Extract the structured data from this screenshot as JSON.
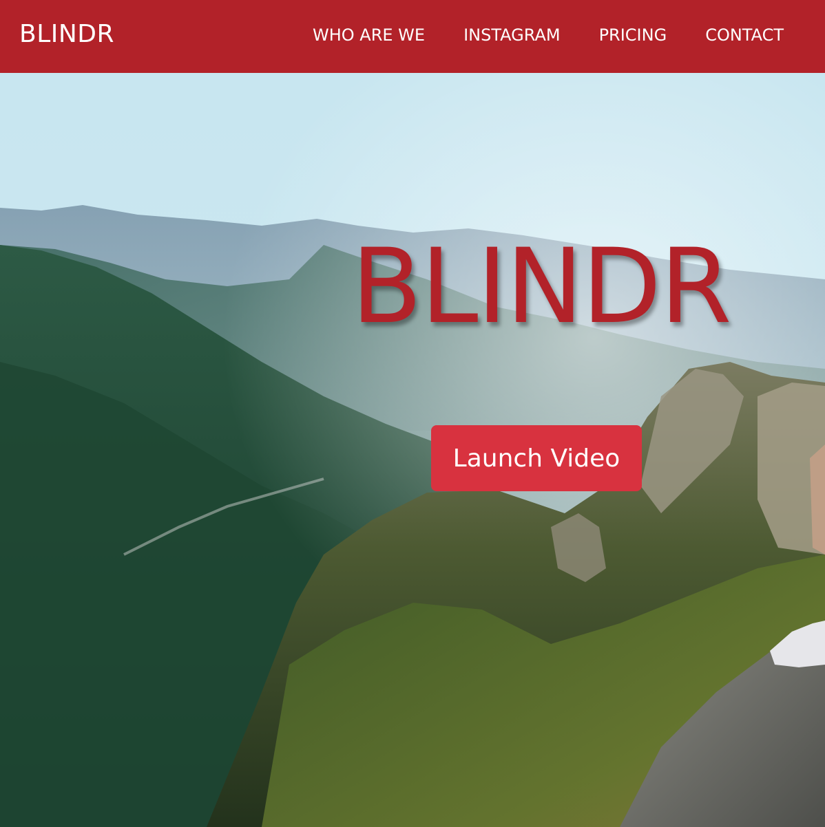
{
  "navbar": {
    "brand": "BLINDR",
    "links": [
      {
        "label": "WHO ARE WE"
      },
      {
        "label": "INSTAGRAM"
      },
      {
        "label": "PRICING"
      },
      {
        "label": "CONTACT"
      }
    ],
    "background_color": "#b22229"
  },
  "hero": {
    "title": "BLINDR",
    "button_label": "Launch Video",
    "title_color": "#b22229",
    "button_color": "#d8323f",
    "background_image": "mountain-valley-landscape-photo"
  }
}
